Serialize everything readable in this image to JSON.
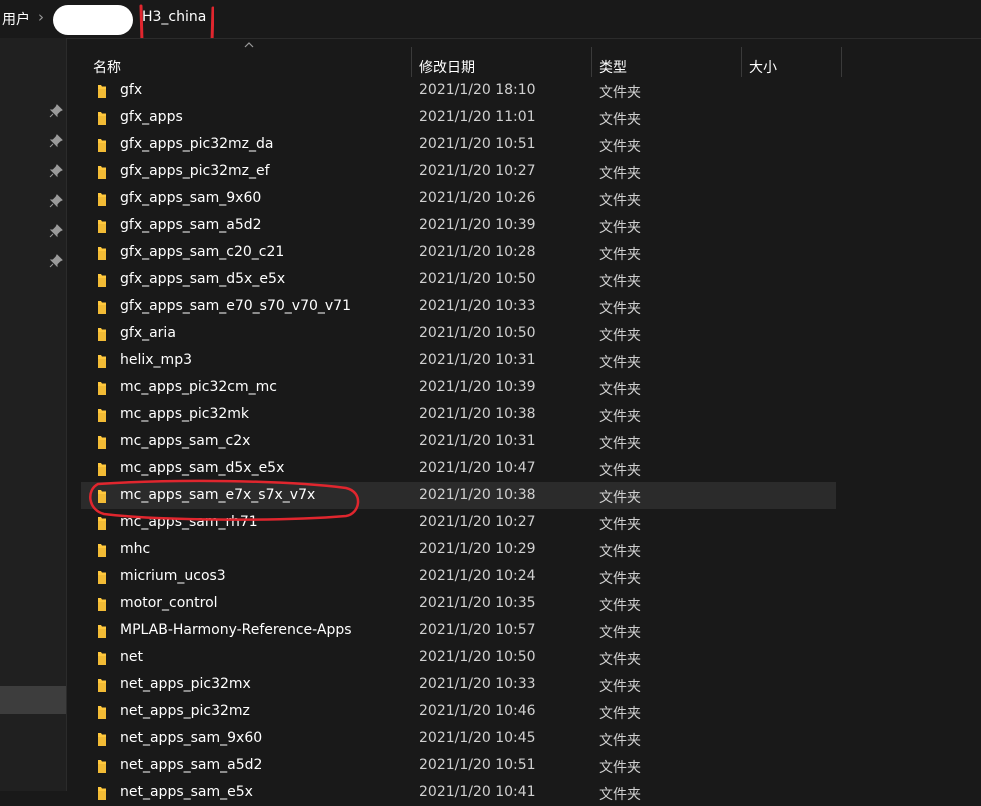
{
  "address": {
    "user_crumb": "用户",
    "folder": "H3_china"
  },
  "columns": {
    "name": "名称",
    "date": "修改日期",
    "type": "类型",
    "size": "大小"
  },
  "accent": "#ffc83d",
  "annotation_color": "#e0262e",
  "files": [
    {
      "name": "gfx",
      "date": "2021/1/20 18:10",
      "type": "文件夹"
    },
    {
      "name": "gfx_apps",
      "date": "2021/1/20 11:01",
      "type": "文件夹"
    },
    {
      "name": "gfx_apps_pic32mz_da",
      "date": "2021/1/20 10:51",
      "type": "文件夹"
    },
    {
      "name": "gfx_apps_pic32mz_ef",
      "date": "2021/1/20 10:27",
      "type": "文件夹"
    },
    {
      "name": "gfx_apps_sam_9x60",
      "date": "2021/1/20 10:26",
      "type": "文件夹"
    },
    {
      "name": "gfx_apps_sam_a5d2",
      "date": "2021/1/20 10:39",
      "type": "文件夹"
    },
    {
      "name": "gfx_apps_sam_c20_c21",
      "date": "2021/1/20 10:28",
      "type": "文件夹"
    },
    {
      "name": "gfx_apps_sam_d5x_e5x",
      "date": "2021/1/20 10:50",
      "type": "文件夹"
    },
    {
      "name": "gfx_apps_sam_e70_s70_v70_v71",
      "date": "2021/1/20 10:33",
      "type": "文件夹"
    },
    {
      "name": "gfx_aria",
      "date": "2021/1/20 10:50",
      "type": "文件夹"
    },
    {
      "name": "helix_mp3",
      "date": "2021/1/20 10:31",
      "type": "文件夹"
    },
    {
      "name": "mc_apps_pic32cm_mc",
      "date": "2021/1/20 10:39",
      "type": "文件夹"
    },
    {
      "name": "mc_apps_pic32mk",
      "date": "2021/1/20 10:38",
      "type": "文件夹"
    },
    {
      "name": "mc_apps_sam_c2x",
      "date": "2021/1/20 10:31",
      "type": "文件夹"
    },
    {
      "name": "mc_apps_sam_d5x_e5x",
      "date": "2021/1/20 10:47",
      "type": "文件夹"
    },
    {
      "name": "mc_apps_sam_e7x_s7x_v7x",
      "date": "2021/1/20 10:38",
      "type": "文件夹"
    },
    {
      "name": "mc_apps_sam_rh71",
      "date": "2021/1/20 10:27",
      "type": "文件夹"
    },
    {
      "name": "mhc",
      "date": "2021/1/20 10:29",
      "type": "文件夹"
    },
    {
      "name": "micrium_ucos3",
      "date": "2021/1/20 10:24",
      "type": "文件夹"
    },
    {
      "name": "motor_control",
      "date": "2021/1/20 10:35",
      "type": "文件夹"
    },
    {
      "name": "MPLAB-Harmony-Reference-Apps",
      "date": "2021/1/20 10:57",
      "type": "文件夹"
    },
    {
      "name": "net",
      "date": "2021/1/20 10:50",
      "type": "文件夹"
    },
    {
      "name": "net_apps_pic32mx",
      "date": "2021/1/20 10:33",
      "type": "文件夹"
    },
    {
      "name": "net_apps_pic32mz",
      "date": "2021/1/20 10:46",
      "type": "文件夹"
    },
    {
      "name": "net_apps_sam_9x60",
      "date": "2021/1/20 10:45",
      "type": "文件夹"
    },
    {
      "name": "net_apps_sam_a5d2",
      "date": "2021/1/20 10:51",
      "type": "文件夹"
    },
    {
      "name": "net_apps_sam_e5x",
      "date": "2021/1/20 10:41",
      "type": "文件夹"
    }
  ]
}
